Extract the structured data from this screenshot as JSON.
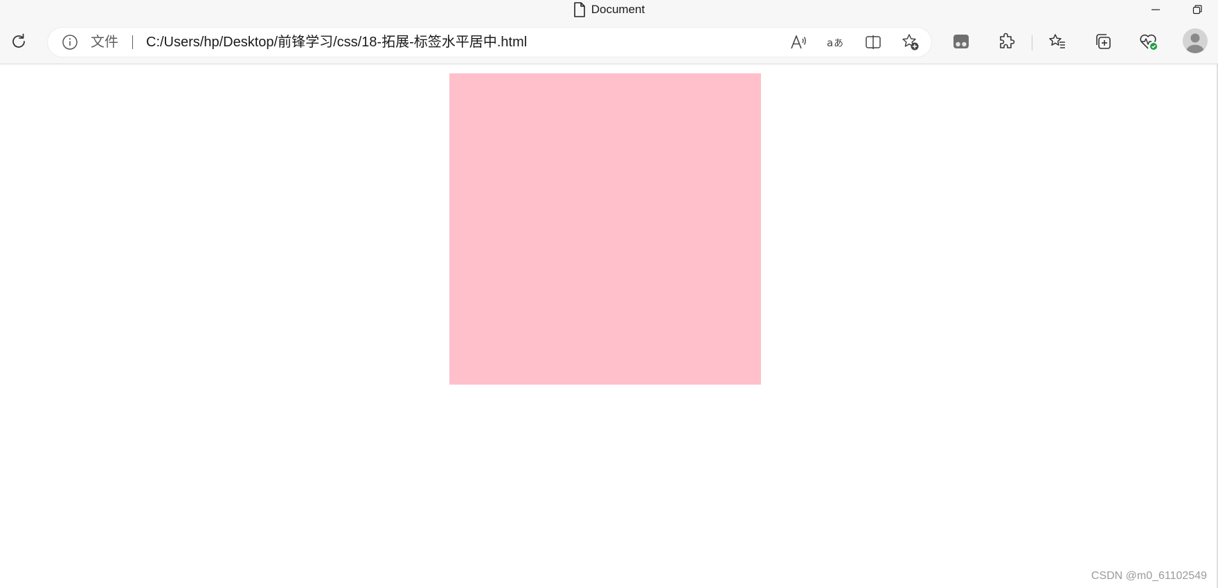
{
  "window": {
    "title": "Document"
  },
  "address_bar": {
    "scheme_label": "文件",
    "url": "C:/Users/hp/Desktop/前锋学习/css/18-拓展-标签水平居中.html"
  },
  "icons": {
    "reload": "reload-icon",
    "info": "info-icon",
    "read_aloud": "read-aloud-icon",
    "translate": "translate-icon",
    "split_screen": "split-screen-icon",
    "add_favorite": "add-favorite-icon",
    "workspaces": "workspaces-icon",
    "extensions": "extensions-icon",
    "favorites": "favorites-icon",
    "collections": "collections-icon",
    "browser_essentials": "browser-essentials-icon",
    "profile": "avatar"
  },
  "page": {
    "box_color": "#ffc0cb"
  },
  "watermark": {
    "text": "CSDN @m0_61102549"
  },
  "colors": {
    "chrome_bg": "#f7f7f7",
    "content_bg": "#ffffff",
    "accent_green": "#1a9e3f"
  }
}
